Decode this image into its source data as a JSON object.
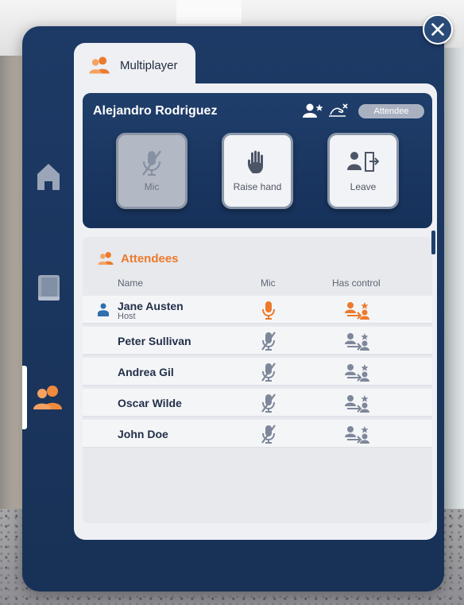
{
  "tab": {
    "label": "Multiplayer",
    "icon": "people-icon"
  },
  "user": {
    "name": "Alejandro Rodriguez",
    "role": "Attendee"
  },
  "actions": [
    {
      "label": "Mic",
      "icon": "mic-muted-icon"
    },
    {
      "label": "Raise hand",
      "icon": "hand-icon"
    },
    {
      "label": "Leave",
      "icon": "leave-door-icon"
    }
  ],
  "attendees": {
    "title": "Attendees",
    "columns": {
      "name": "Name",
      "mic": "Mic",
      "control": "Has control"
    },
    "rows": [
      {
        "name": "Jane Austen",
        "subtitle": "Host",
        "mic": "active"
      },
      {
        "name": "Peter Sullivan",
        "subtitle": "",
        "mic": "muted"
      },
      {
        "name": "Andrea Gil",
        "subtitle": "",
        "mic": "muted"
      },
      {
        "name": "Oscar Wilde",
        "subtitle": "",
        "mic": "muted"
      },
      {
        "name": "John Doe",
        "subtitle": "",
        "mic": "muted"
      }
    ]
  },
  "colors": {
    "accent": "#ec7a2c",
    "panel": "#1d3a66",
    "muted_icon": "#7e879a"
  }
}
